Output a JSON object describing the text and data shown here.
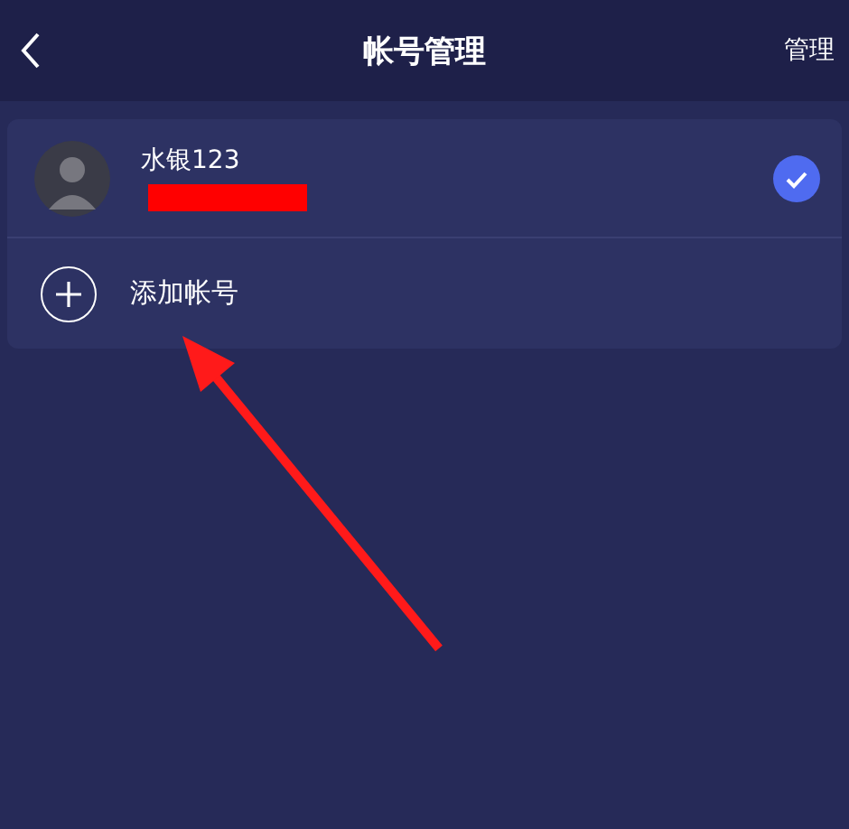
{
  "header": {
    "title": "帐号管理",
    "action": "管理"
  },
  "accounts": [
    {
      "name": "水银123",
      "selected": true
    }
  ],
  "add_account": {
    "label": "添加帐号"
  }
}
